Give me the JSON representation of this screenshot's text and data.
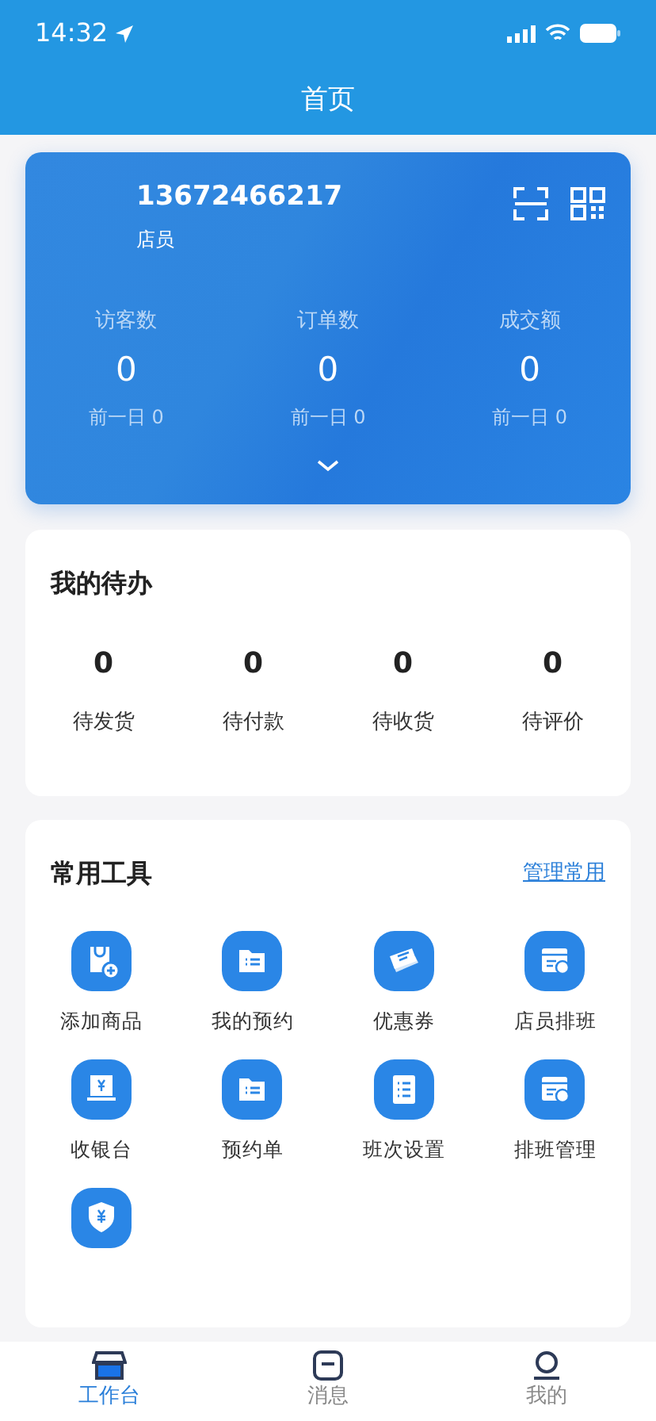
{
  "status_bar": {
    "time": "14:32"
  },
  "header": {
    "title": "首页"
  },
  "profile": {
    "phone": "13672466217",
    "role": "店员"
  },
  "stats": [
    {
      "label": "访客数",
      "value": "0",
      "previous": "前一日 0"
    },
    {
      "label": "订单数",
      "value": "0",
      "previous": "前一日 0"
    },
    {
      "label": "成交额",
      "value": "0",
      "previous": "前一日 0"
    }
  ],
  "todo": {
    "title": "我的待办",
    "items": [
      {
        "count": "0",
        "label": "待发货"
      },
      {
        "count": "0",
        "label": "待付款"
      },
      {
        "count": "0",
        "label": "待收货"
      },
      {
        "count": "0",
        "label": "待评价"
      }
    ]
  },
  "tools": {
    "title": "常用工具",
    "manage_link": "管理常用",
    "items": [
      {
        "kind": "bag",
        "label": "添加商品"
      },
      {
        "kind": "folder",
        "label": "我的预约"
      },
      {
        "kind": "ticket",
        "label": "优惠券"
      },
      {
        "kind": "calendar",
        "label": "店员排班"
      },
      {
        "kind": "cashier",
        "label": "收银台"
      },
      {
        "kind": "folder",
        "label": "预约单"
      },
      {
        "kind": "list",
        "label": "班次设置"
      },
      {
        "kind": "calendar",
        "label": "排班管理"
      },
      {
        "kind": "shield"
      }
    ]
  },
  "tab_bar": [
    {
      "kind": "workbench",
      "label": "工作台",
      "selected": true
    },
    {
      "kind": "message",
      "label": "消息",
      "selected": false
    },
    {
      "kind": "profile",
      "label": "我的",
      "selected": false
    }
  ]
}
